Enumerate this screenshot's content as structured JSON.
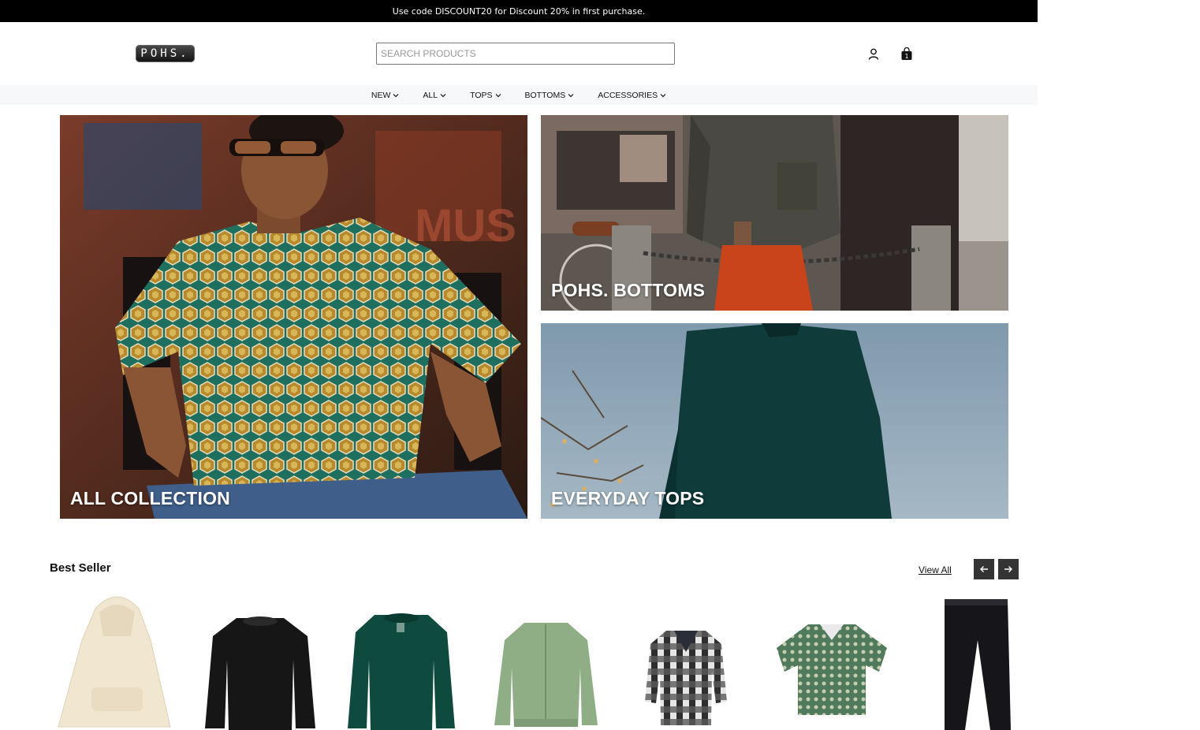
{
  "announcement": "Use code DISCOUNT20 for Discount 20% in first purchase.",
  "header": {
    "logo": "POHS.",
    "search_placeholder": "SEARCH PRODUCTS",
    "account_icon": "user-icon",
    "cart_icon": "shopping-bag-icon",
    "cart_count": "1"
  },
  "nav": {
    "items": [
      {
        "label": "NEW"
      },
      {
        "label": "ALL"
      },
      {
        "label": "TOPS"
      },
      {
        "label": "BOTTOMS"
      },
      {
        "label": "ACCESSORIES"
      }
    ]
  },
  "banners": {
    "all_collection": "ALL COLLECTION",
    "bottoms": "POHS. BOTTOMS",
    "tops": "EVERYDAY TOPS"
  },
  "best_seller": {
    "title": "Best Seller",
    "view_all": "View All",
    "prev_icon": "arrow-left-icon",
    "next_icon": "arrow-right-icon",
    "products": [
      {
        "icon": "cream-hoodie",
        "color": "#f1e6cf"
      },
      {
        "icon": "black-sweater",
        "color": "#161616"
      },
      {
        "icon": "green-sweatshirt",
        "color": "#0e4a3e"
      },
      {
        "icon": "green-bomber-jacket",
        "color": "#8fae86"
      },
      {
        "icon": "plaid-flannel-shirt",
        "color": "#3a3a3a"
      },
      {
        "icon": "patterned-shirt",
        "color": "#4f7a5c"
      },
      {
        "icon": "black-jeans",
        "color": "#15151a"
      }
    ]
  },
  "colors": {
    "announcement_bg": "#000000",
    "nav_bg": "#f7f8f9",
    "arrow_bg": "#343434"
  }
}
